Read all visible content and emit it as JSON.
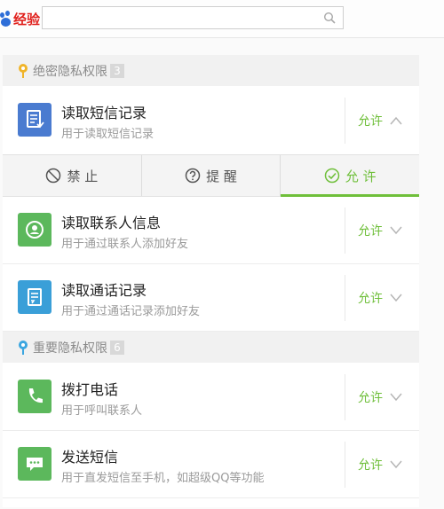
{
  "logo": {
    "text": "经验"
  },
  "search": {
    "value": "",
    "placeholder": ""
  },
  "sections": [
    {
      "title": "绝密隐私权限",
      "count": "3",
      "pin_color": "#f0b429"
    },
    {
      "title": "重要隐私权限",
      "count": "6",
      "pin_color": "#3ba6e0"
    }
  ],
  "rows": [
    {
      "title": "读取短信记录",
      "desc": "用于读取短信记录",
      "state": "允许",
      "icon": "sms-read-icon",
      "color": "#4a7bd0"
    },
    {
      "title": "读取联系人信息",
      "desc": "用于通过联系人添加好友",
      "state": "允许",
      "icon": "contact-icon",
      "color": "#5cb85c"
    },
    {
      "title": "读取通话记录",
      "desc": "用于通过通话记录添加好友",
      "state": "允许",
      "icon": "call-log-icon",
      "color": "#3a9fd8"
    },
    {
      "title": "拨打电话",
      "desc": "用于呼叫联系人",
      "state": "允许",
      "icon": "phone-icon",
      "color": "#5cb85c"
    },
    {
      "title": "发送短信",
      "desc": "用于直发短信至手机，如超级QQ等功能",
      "state": "允许",
      "icon": "sms-send-icon",
      "color": "#5cb85c"
    }
  ],
  "actions": [
    {
      "label": "禁 止",
      "icon": "forbid-icon"
    },
    {
      "label": "提 醒",
      "icon": "question-icon"
    },
    {
      "label": "允 许",
      "icon": "check-icon",
      "active": true
    }
  ],
  "accent": "#6fbf3a"
}
